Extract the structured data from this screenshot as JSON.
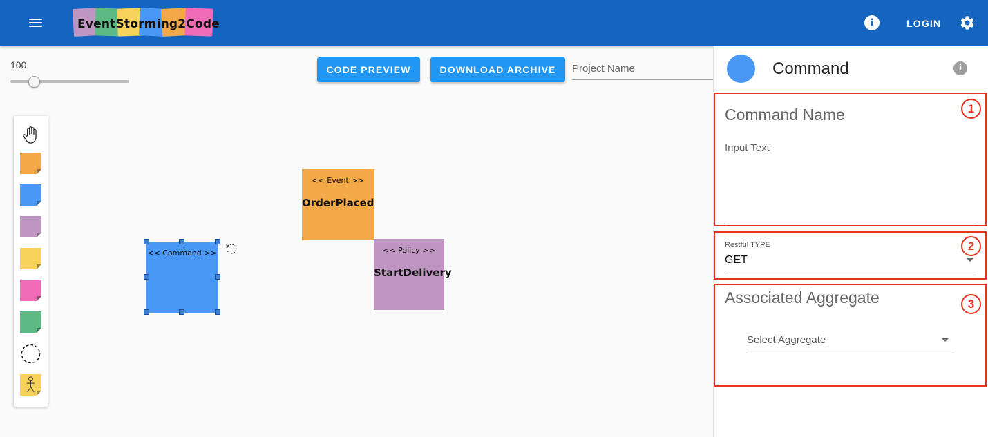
{
  "app": {
    "logo_text": "EventStorming2Code",
    "logo_colors": [
      "#bf95c2",
      "#5dba84",
      "#f7d35b",
      "#4a98f5",
      "#f4a949",
      "#f06bb5"
    ],
    "login_label": "LOGIN",
    "brand_color": "#1565c0"
  },
  "toolbar": {
    "zoom_value": "100",
    "zoom_level": 0.2,
    "code_preview_label": "CODE PREVIEW",
    "download_archive_label": "DOWNLOAD ARCHIVE",
    "project_name_placeholder": "Project Name",
    "project_name_value": ""
  },
  "palette": {
    "items": [
      {
        "name": "hand-tool",
        "icon": "hand-icon"
      },
      {
        "name": "event-sticky",
        "color": "#f4a949"
      },
      {
        "name": "command-sticky",
        "color": "#4a98f5"
      },
      {
        "name": "policy-sticky",
        "color": "#bf95c2"
      },
      {
        "name": "aggregate-sticky",
        "color": "#f7d35b"
      },
      {
        "name": "external-sticky",
        "color": "#f06bb5"
      },
      {
        "name": "view-sticky",
        "color": "#5dba84"
      },
      {
        "name": "bounded-context",
        "icon": "dashed-circle-icon"
      },
      {
        "name": "actor-sticky",
        "color": "#f7d35b",
        "icon": "stick-figure-icon"
      }
    ]
  },
  "canvas": {
    "event": {
      "stereotype": "<< Event >>",
      "name": "OrderPlaced",
      "color": "#f4a949"
    },
    "policy": {
      "stereotype": "<< Policy >>",
      "name": "StartDelivery",
      "color": "#bf95c2"
    },
    "command": {
      "stereotype": "<< Command >>",
      "name": "",
      "color": "#4a98f5"
    }
  },
  "panel": {
    "title": "Command",
    "command_name_label": "Command Name",
    "command_name_placeholder": "Input Text",
    "restful_type_label": "Restful TYPE",
    "restful_type_value": "GET",
    "associated_aggregate_label": "Associated Aggregate",
    "select_aggregate_placeholder": "Select Aggregate",
    "callouts": [
      "1",
      "2",
      "3"
    ],
    "callout_color": "#e8321f"
  }
}
